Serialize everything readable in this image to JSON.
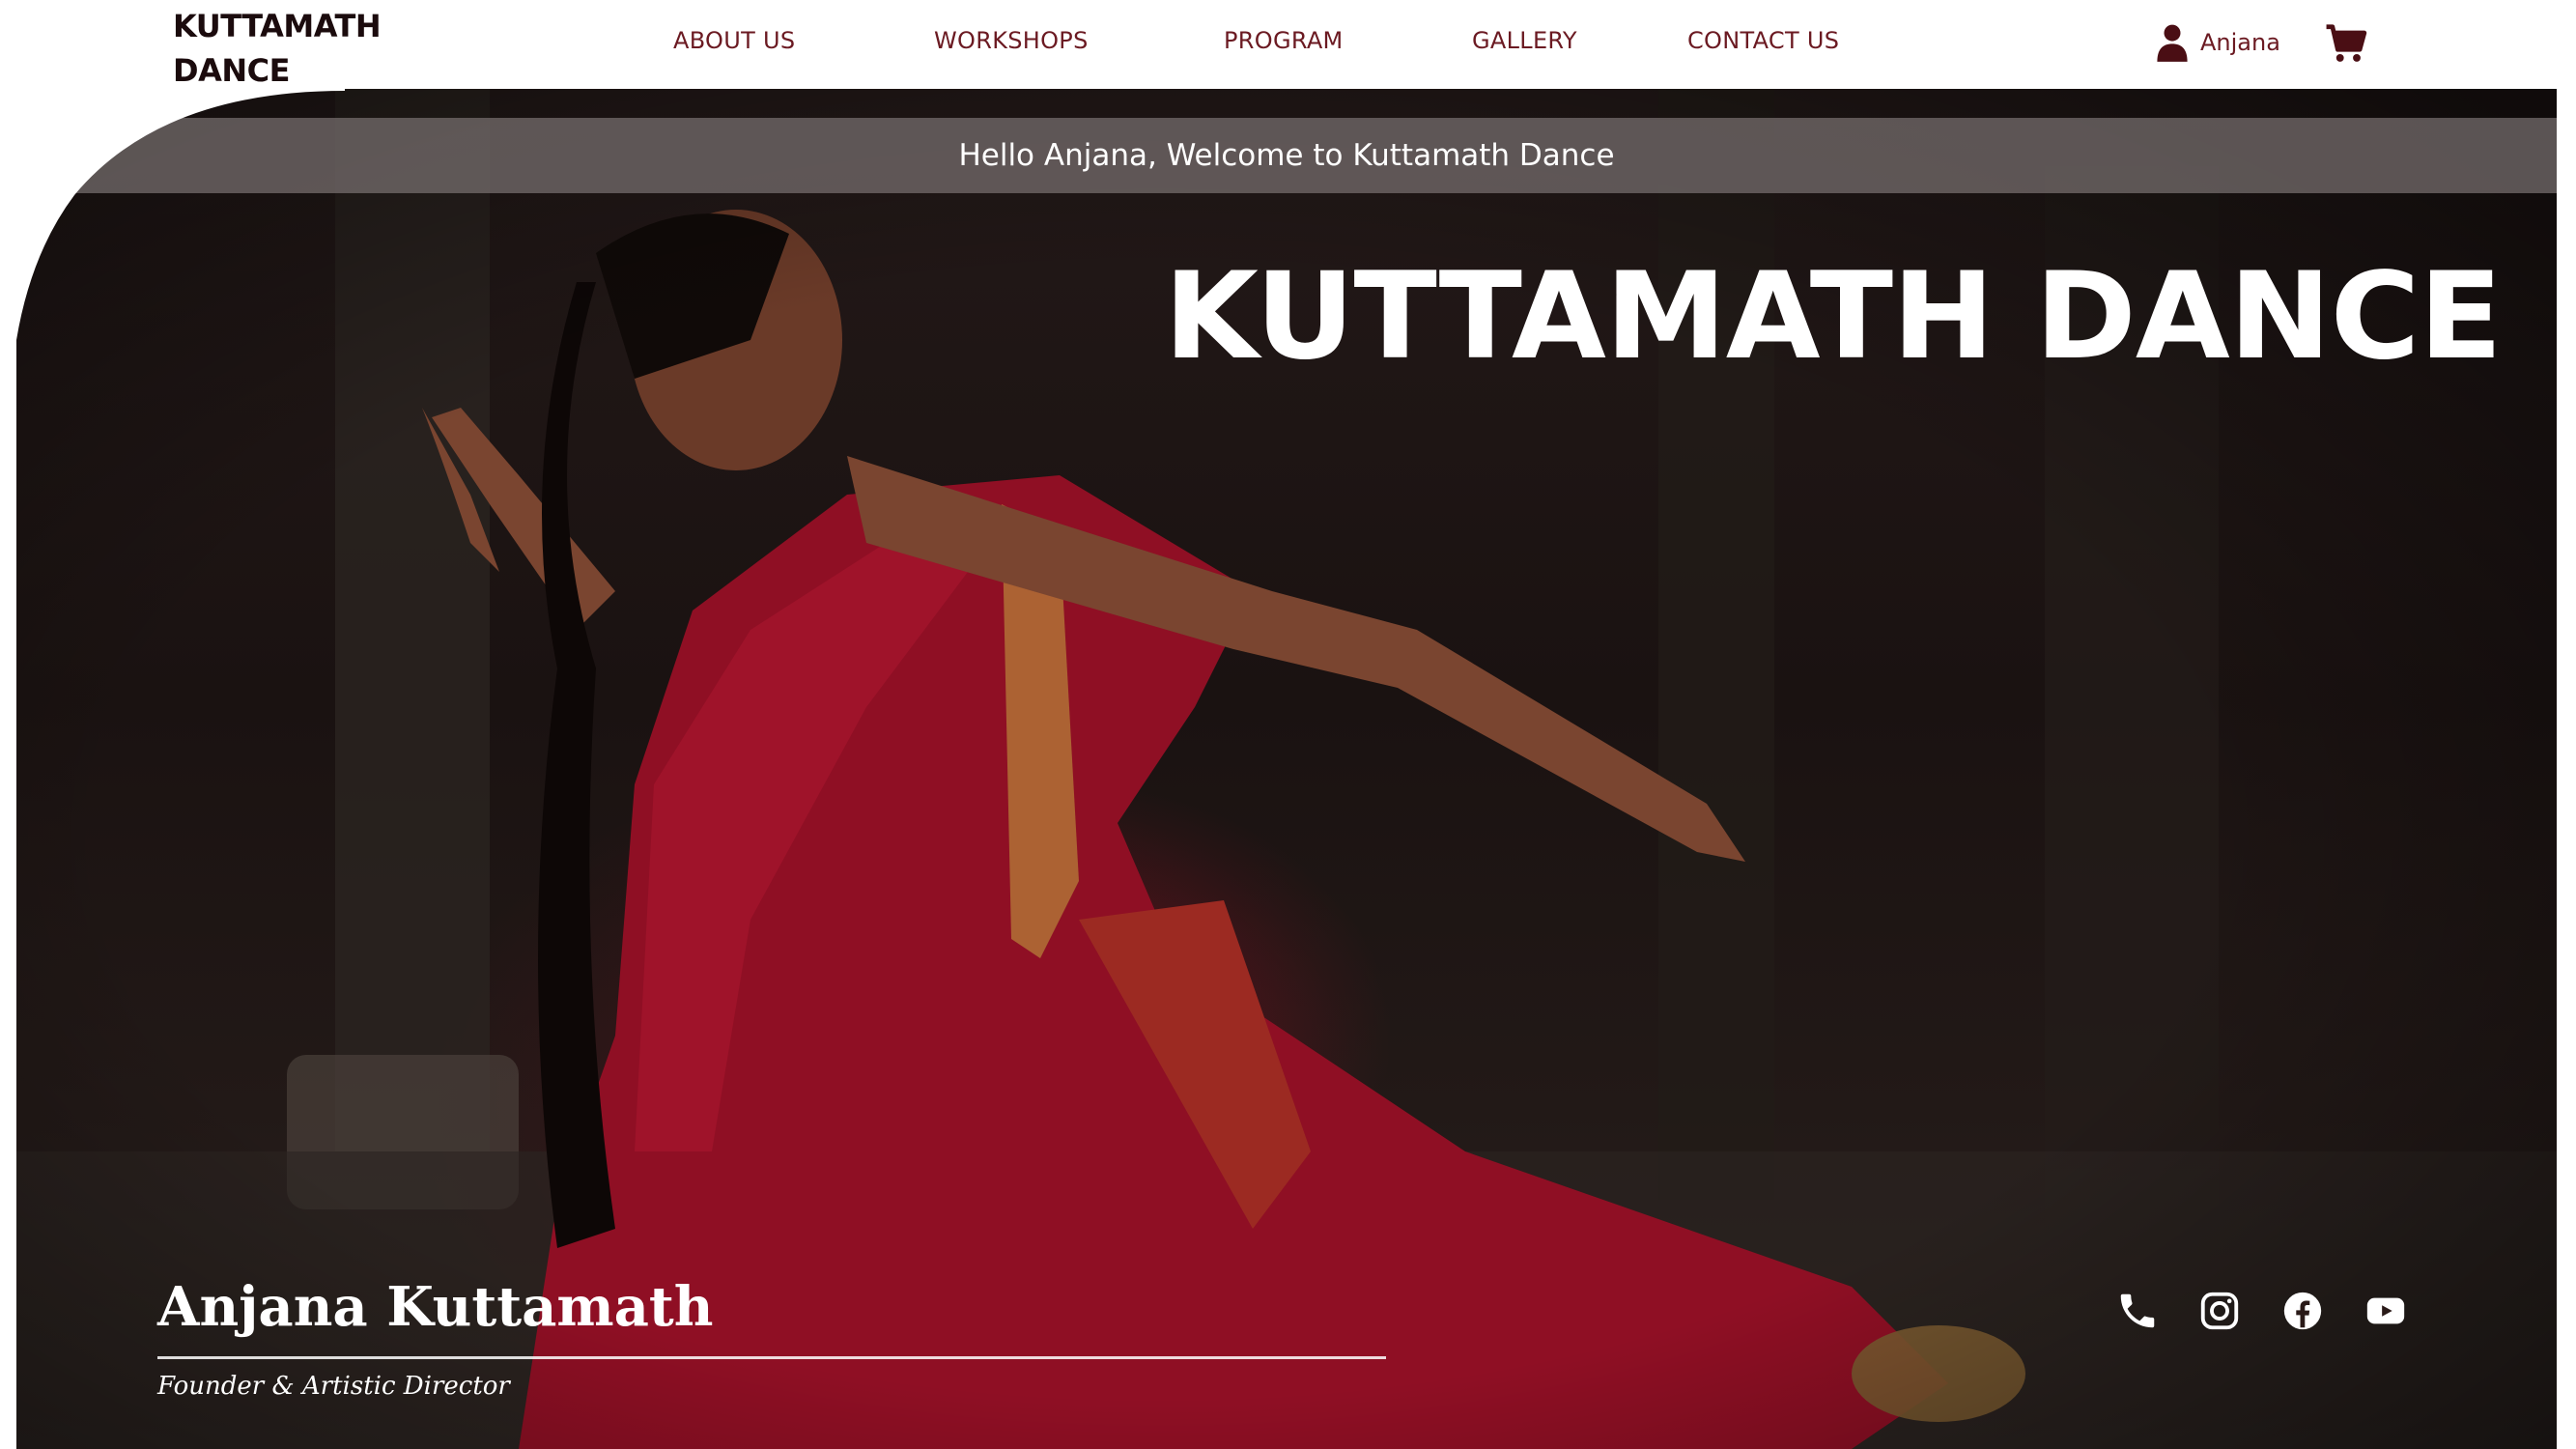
{
  "header": {
    "logo_line1": "KUTTAMATH",
    "logo_line2": "DANCE",
    "nav": [
      {
        "label": "ABOUT US"
      },
      {
        "label": "WORKSHOPS"
      },
      {
        "label": "PROGRAM"
      },
      {
        "label": "GALLERY"
      },
      {
        "label": "CONTACT US"
      }
    ],
    "user": {
      "name": "Anjana",
      "icon": "user-icon"
    },
    "cart": {
      "icon": "cart-icon"
    }
  },
  "hero": {
    "welcome": "Hello Anjana, Welcome to Kuttamath Dance",
    "title": "KUTTAMATH DANCE",
    "image": "dancer-in-red-saree",
    "founder_name": "Anjana Kuttamath",
    "founder_role": "Founder & Artistic Director",
    "socials": [
      {
        "icon": "phone-icon"
      },
      {
        "icon": "instagram-icon"
      },
      {
        "icon": "facebook-icon"
      },
      {
        "icon": "youtube-icon"
      }
    ]
  },
  "colors": {
    "nav_text": "#6b1a22",
    "logo_text": "#1b0b0d",
    "hero_bg": "#1a1211",
    "saree": "#8f0f24",
    "welcome_bar": "#787070"
  }
}
